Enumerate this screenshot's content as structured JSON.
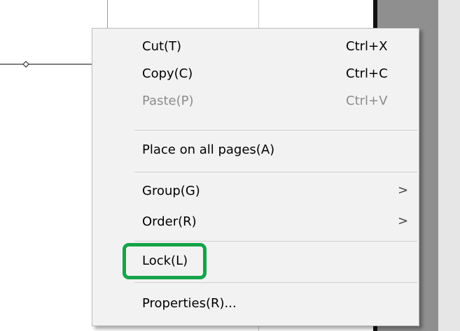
{
  "context_menu": {
    "items": [
      {
        "label": "Cut(T)",
        "shortcut": "Ctrl+X",
        "enabled": true,
        "submenu": false
      },
      {
        "label": "Copy(C)",
        "shortcut": "Ctrl+C",
        "enabled": true,
        "submenu": false
      },
      {
        "label": "Paste(P)",
        "shortcut": "Ctrl+V",
        "enabled": false,
        "submenu": false
      },
      {
        "label": "Place on all pages(A)",
        "shortcut": "",
        "enabled": true,
        "submenu": false
      },
      {
        "label": "Group(G)",
        "shortcut": "",
        "enabled": true,
        "submenu": true
      },
      {
        "label": "Order(R)",
        "shortcut": "",
        "enabled": true,
        "submenu": true
      },
      {
        "label": "Lock(L)",
        "shortcut": "",
        "enabled": true,
        "submenu": false,
        "highlighted": true
      },
      {
        "label": "Properties(R)...",
        "shortcut": "",
        "enabled": true,
        "submenu": false
      }
    ],
    "submenu_arrow": ">",
    "highlight_color": "#16a34a"
  }
}
